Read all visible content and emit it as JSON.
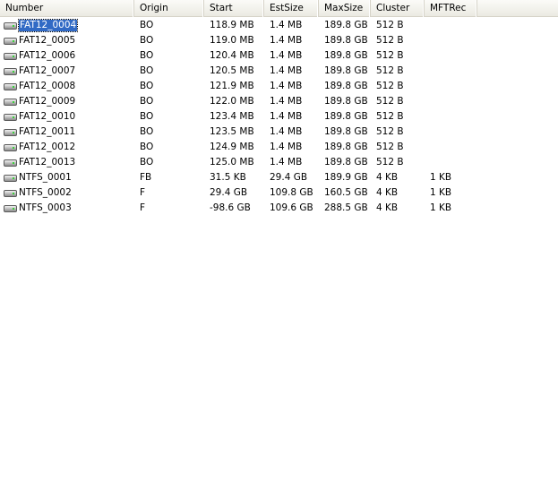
{
  "columns": [
    {
      "label": "Number"
    },
    {
      "label": "Origin"
    },
    {
      "label": "Start"
    },
    {
      "label": "EstSize"
    },
    {
      "label": "MaxSize"
    },
    {
      "label": "Cluster"
    },
    {
      "label": "MFTRec"
    }
  ],
  "icon": "disk-drive-icon",
  "selected_row": "FAT12_0004",
  "rows": [
    {
      "number": "FAT12_0004",
      "origin": "BO",
      "start": "118.9 MB",
      "estsize": "1.4 MB",
      "maxsize": "189.8 GB",
      "cluster": "512 B",
      "mftrec": ""
    },
    {
      "number": "FAT12_0005",
      "origin": "BO",
      "start": "119.0 MB",
      "estsize": "1.4 MB",
      "maxsize": "189.8 GB",
      "cluster": "512 B",
      "mftrec": ""
    },
    {
      "number": "FAT12_0006",
      "origin": "BO",
      "start": "120.4 MB",
      "estsize": "1.4 MB",
      "maxsize": "189.8 GB",
      "cluster": "512 B",
      "mftrec": ""
    },
    {
      "number": "FAT12_0007",
      "origin": "BO",
      "start": "120.5 MB",
      "estsize": "1.4 MB",
      "maxsize": "189.8 GB",
      "cluster": "512 B",
      "mftrec": ""
    },
    {
      "number": "FAT12_0008",
      "origin": "BO",
      "start": "121.9 MB",
      "estsize": "1.4 MB",
      "maxsize": "189.8 GB",
      "cluster": "512 B",
      "mftrec": ""
    },
    {
      "number": "FAT12_0009",
      "origin": "BO",
      "start": "122.0 MB",
      "estsize": "1.4 MB",
      "maxsize": "189.8 GB",
      "cluster": "512 B",
      "mftrec": ""
    },
    {
      "number": "FAT12_0010",
      "origin": "BO",
      "start": "123.4 MB",
      "estsize": "1.4 MB",
      "maxsize": "189.8 GB",
      "cluster": "512 B",
      "mftrec": ""
    },
    {
      "number": "FAT12_0011",
      "origin": "BO",
      "start": "123.5 MB",
      "estsize": "1.4 MB",
      "maxsize": "189.8 GB",
      "cluster": "512 B",
      "mftrec": ""
    },
    {
      "number": "FAT12_0012",
      "origin": "BO",
      "start": "124.9 MB",
      "estsize": "1.4 MB",
      "maxsize": "189.8 GB",
      "cluster": "512 B",
      "mftrec": ""
    },
    {
      "number": "FAT12_0013",
      "origin": "BO",
      "start": "125.0 MB",
      "estsize": "1.4 MB",
      "maxsize": "189.8 GB",
      "cluster": "512 B",
      "mftrec": ""
    },
    {
      "number": "NTFS_0001",
      "origin": "FB",
      "start": "31.5 KB",
      "estsize": "29.4 GB",
      "maxsize": "189.9 GB",
      "cluster": "4 KB",
      "mftrec": "1 KB"
    },
    {
      "number": "NTFS_0002",
      "origin": "F",
      "start": "29.4 GB",
      "estsize": "109.8 GB",
      "maxsize": "160.5 GB",
      "cluster": "4 KB",
      "mftrec": "1 KB"
    },
    {
      "number": "NTFS_0003",
      "origin": "F",
      "start": "-98.6 GB",
      "estsize": "109.6 GB",
      "maxsize": "288.5 GB",
      "cluster": "4 KB",
      "mftrec": "1 KB"
    }
  ]
}
